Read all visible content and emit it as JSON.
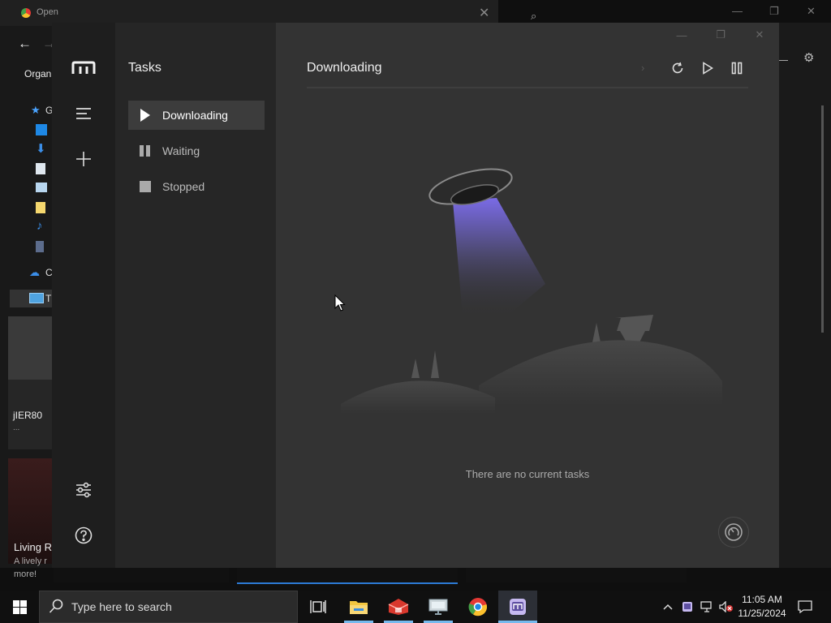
{
  "background": {
    "dialog_title": "Open",
    "organize_label": "Organ",
    "tree_items": [
      "G",
      "C",
      "T"
    ],
    "card1_title": "jIER80",
    "card1_sub": "...",
    "card2_title": "Living R",
    "card2_line1": "A lively r",
    "card2_line2": "more!"
  },
  "app": {
    "sidebar_title": "Tasks",
    "sidebar_items": [
      {
        "label": "Downloading",
        "icon": "play-icon",
        "active": true
      },
      {
        "label": "Waiting",
        "icon": "pause-icon",
        "active": false
      },
      {
        "label": "Stopped",
        "icon": "stop-icon",
        "active": false
      }
    ],
    "main_title": "Downloading",
    "empty_message": "There are no current tasks",
    "toolbar": [
      "refresh-icon",
      "resume-all-icon",
      "pause-all-icon"
    ],
    "rail": [
      "menu-icon",
      "add-task-icon",
      "preferences-icon",
      "help-icon"
    ]
  },
  "taskbar": {
    "search_placeholder": "Type here to search",
    "time": "11:05 AM",
    "date": "11/25/2024",
    "apps": [
      "task-view-icon",
      "file-explorer-icon",
      "app-red-icon",
      "remote-desktop-icon",
      "chrome-icon",
      "motrix-icon"
    ]
  },
  "colors": {
    "accent": "#76b9ed",
    "app_bg": "#333333",
    "sidebar_bg": "#262626",
    "rail_bg": "#1e1e1e",
    "ufo_beam": "#6a5acd"
  }
}
